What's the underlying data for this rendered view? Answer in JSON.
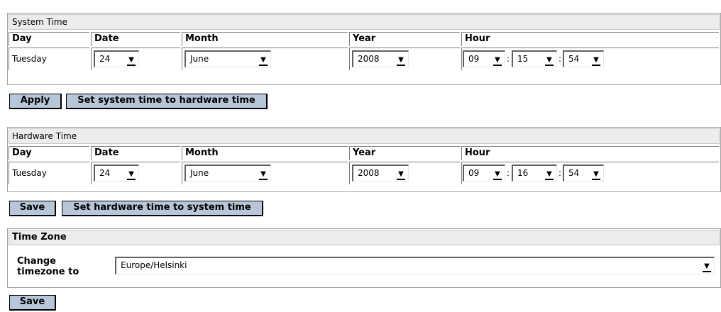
{
  "system_time": {
    "title": "System Time",
    "headers": [
      "Day",
      "Date",
      "Month",
      "Year",
      "Hour"
    ],
    "day": "Tuesday",
    "date": "24",
    "month": "June",
    "year": "2008",
    "hour": "09",
    "minute": "15",
    "second": "54",
    "colon": ":"
  },
  "system_buttons": {
    "apply": "Apply",
    "set_system_to_hw": "Set system time to hardware time"
  },
  "hardware_time": {
    "title": "Hardware Time",
    "headers": [
      "Day",
      "Date",
      "Month",
      "Year",
      "Hour"
    ],
    "day": "Tuesday",
    "date": "24",
    "month": "June",
    "year": "2008",
    "hour": "09",
    "minute": "16",
    "second": "54",
    "colon": ":"
  },
  "hardware_buttons": {
    "save": "Save",
    "set_hw_to_system": "Set hardware time to system time"
  },
  "time_zone": {
    "title": "Time Zone",
    "label": "Change timezone to",
    "value": "Europe/Helsinki"
  },
  "time_zone_buttons": {
    "save": "Save"
  },
  "icons": {
    "dropdown_arrow": "▼"
  }
}
